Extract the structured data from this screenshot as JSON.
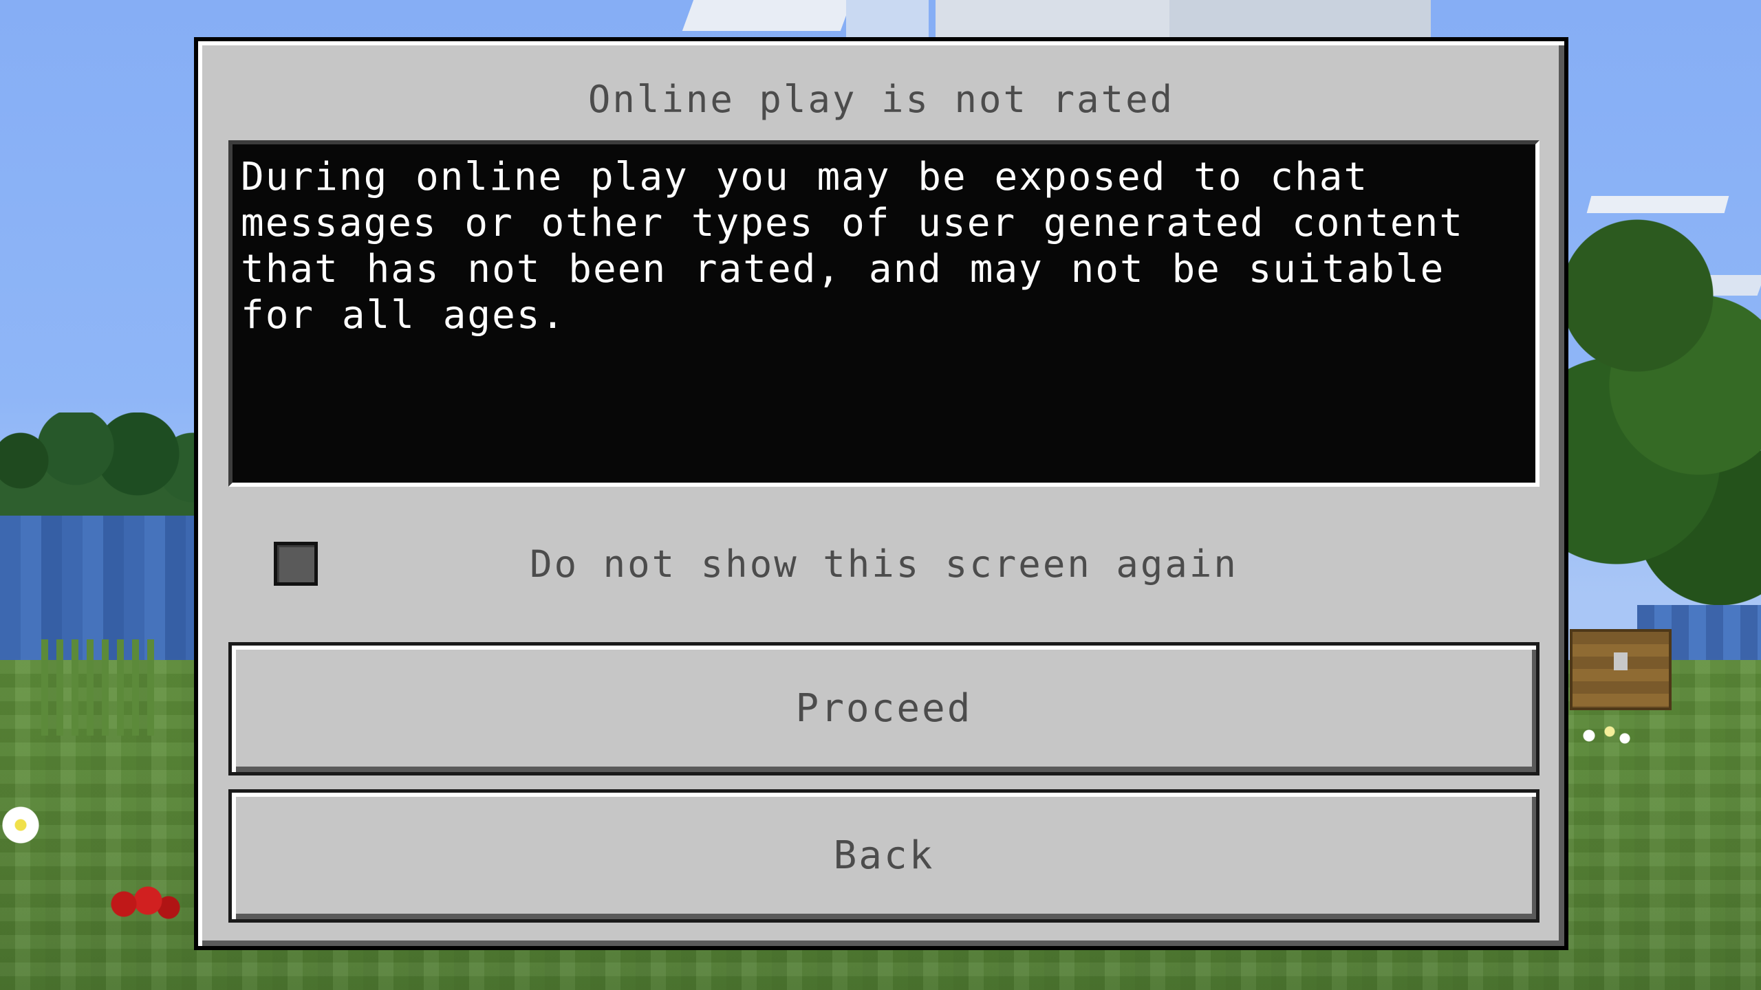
{
  "dialog": {
    "title": "Online play is not rated",
    "message": "During online play you may be exposed to chat messages or other types of user generated content that has not been rated, and may not be suitable for all ages.",
    "checkbox": {
      "label": "Do not show this screen again",
      "checked": false
    },
    "buttons": {
      "proceed_label": "Proceed",
      "back_label": "Back"
    }
  },
  "colors": {
    "panel": "#c6c6c6",
    "message_background": "#070707",
    "text_dark": "#4c4c4c",
    "text_light": "#ffffff"
  }
}
